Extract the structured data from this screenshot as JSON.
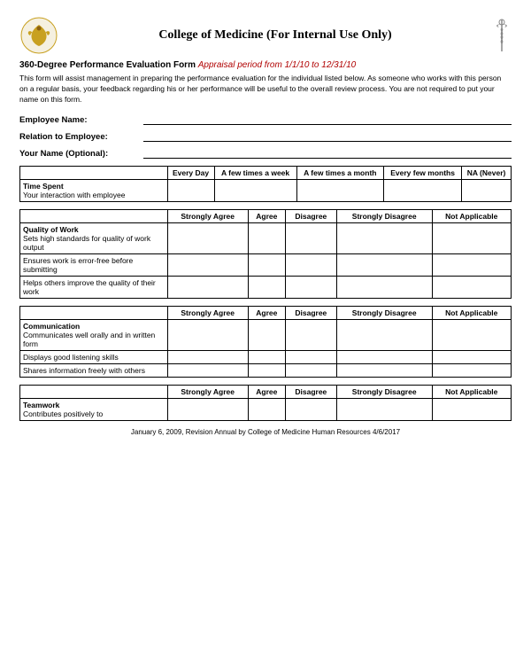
{
  "header": {
    "title": "College of Medicine (For Internal Use Only)",
    "logo_left_alt": "college-logo",
    "logo_right_alt": "caduceus-logo"
  },
  "form": {
    "title_bold": "360-Degree Performance Evaluation Form",
    "title_italic": "Appraisal period from 1/1/10 to 12/31/10",
    "description": "This form will assist management in preparing the performance evaluation for the individual listed below. As someone who works with this person on a regular basis, your feedback regarding his or her performance will be useful to the overall review process. You are not required to put your name on this form.",
    "employee_name_label": "Employee Name:",
    "relation_label": "Relation to Employee:",
    "your_name_label": "Your Name (Optional):"
  },
  "table1": {
    "col_headers": [
      "Every Day",
      "A few times a week",
      "A few times a month",
      "Every few months",
      "NA (Never)"
    ],
    "row_label": "Time Spent",
    "row_label_col": "Time Spent",
    "rows": [
      "Your interaction with employee"
    ]
  },
  "table2": {
    "section": "Quality of Work",
    "col_headers": [
      "Strongly Agree",
      "Agree",
      "Disagree",
      "Strongly Disagree",
      "Not Applicable"
    ],
    "rows": [
      "Sets high standards for quality of work output",
      "Ensures work is error-free before submitting",
      "Helps others improve the quality of their work"
    ]
  },
  "table3": {
    "section": "Communication",
    "col_headers": [
      "Strongly Agree",
      "Agree",
      "Disagree",
      "Strongly Disagree",
      "Not Applicable"
    ],
    "rows": [
      "Communicates well orally and in written form",
      "Displays good listening skills",
      "Shares information freely with others"
    ]
  },
  "table4": {
    "section": "Teamwork",
    "col_headers": [
      "Strongly Agree",
      "Agree",
      "Disagree",
      "Strongly Disagree",
      "Not Applicable"
    ],
    "rows": [
      "Contributes positively to"
    ]
  },
  "footer": {
    "text": "January 6, 2009, Revision Annual by College of Medicine Human Resources 4/6/2017"
  }
}
